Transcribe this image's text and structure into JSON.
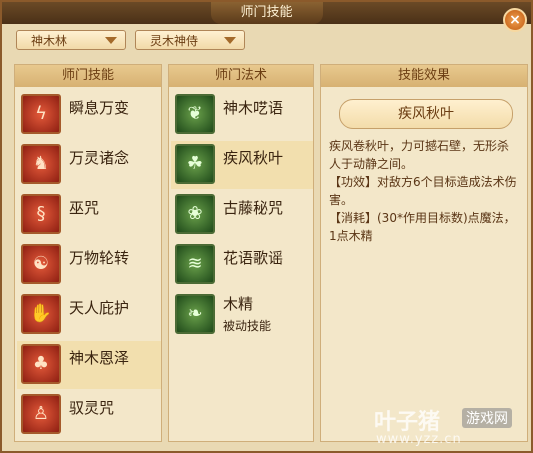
{
  "window": {
    "title": "师门技能",
    "close_icon": "close-icon"
  },
  "dropdowns": [
    {
      "value": "神木林"
    },
    {
      "value": "灵木神侍"
    }
  ],
  "panels": {
    "skills": {
      "header": "师门技能"
    },
    "spells": {
      "header": "师门法术"
    },
    "effect": {
      "header": "技能效果"
    }
  },
  "skills": [
    {
      "label": "瞬息万变",
      "icon": "lightning-icon",
      "selected": false
    },
    {
      "label": "万灵诸念",
      "icon": "beast-spirit-icon",
      "selected": false
    },
    {
      "label": "巫咒",
      "icon": "swirl-curse-icon",
      "selected": false
    },
    {
      "label": "万物轮转",
      "icon": "yin-yang-icon",
      "selected": false
    },
    {
      "label": "天人庇护",
      "icon": "praying-hands-icon",
      "selected": false
    },
    {
      "label": "神木恩泽",
      "icon": "tree-icon",
      "selected": true
    },
    {
      "label": "驭灵咒",
      "icon": "figure-spell-icon",
      "selected": false
    }
  ],
  "spells": [
    {
      "label": "神木呓语",
      "sub": "",
      "icon": "leaf-sprout-icon",
      "selected": false
    },
    {
      "label": "疾风秋叶",
      "sub": "",
      "icon": "wind-leaf-icon",
      "selected": true
    },
    {
      "label": "古藤秘咒",
      "sub": "",
      "icon": "vine-icon",
      "selected": false
    },
    {
      "label": "花语歌谣",
      "sub": "",
      "icon": "grass-wave-icon",
      "selected": false
    },
    {
      "label": "木精",
      "sub": "被动技能",
      "icon": "seedling-icon",
      "selected": false
    }
  ],
  "effect": {
    "name": "疾风秋叶",
    "description": "疾风卷秋叶，力可撼石壁，无形杀人于动静之间。\n【功效】对敌方6个目标造成法术伤害。\n【消耗】(30*作用目标数)点魔法，1点木精"
  },
  "watermark": {
    "text": "叶子猪",
    "tag": "游戏网",
    "url": "www.yzz.cn"
  }
}
